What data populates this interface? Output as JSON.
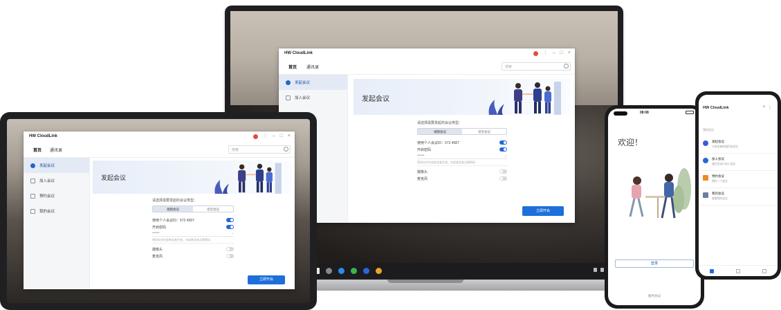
{
  "app": {
    "name": "HW CloudLink"
  },
  "nav": {
    "home": "首页",
    "contacts": "通讯录",
    "search_placeholder": "搜索"
  },
  "sidebar": {
    "items": [
      {
        "label": "发起会议"
      },
      {
        "label": "加入会议"
      },
      {
        "label": "预约会议"
      },
      {
        "label": "我的会议"
      }
    ]
  },
  "banner": {
    "title": "发起会议"
  },
  "form": {
    "hint": "请选择需要发起的会议类型：",
    "segments": [
      "视频会议",
      "语音会议"
    ],
    "use_personal_id": "使用个人会议ID：573 4587",
    "enable_password": "开启密码",
    "password_value": "••••••",
    "note": "密码仅对外部参会者生效，内部参会者无需密码",
    "camera": "摄像头",
    "microphone": "麦克风",
    "start_button": "立即开会"
  },
  "phone1": {
    "status_time": "08:08",
    "welcome": "欢迎！",
    "login_button": "登录",
    "footer": "服务协议"
  },
  "phone2": {
    "title": "HW CloudLink",
    "list_header": "我的会议",
    "items": [
      {
        "title": "发起会议",
        "sub": "与参会者快速开始会议",
        "color": "#3d5ad8"
      },
      {
        "title": "加入会议",
        "sub": "通过会议ID加入会议",
        "color": "#2a67d6"
      },
      {
        "title": "预约会议",
        "sub": "预约一个会议",
        "color": "#f08a1e"
      },
      {
        "title": "我的会议",
        "sub": "查看我的会议",
        "color": "#6d7fa0"
      }
    ]
  },
  "colors": {
    "accent": "#1e6fd9",
    "active_bg": "#e3eaf5",
    "record": "#e84a3d"
  }
}
